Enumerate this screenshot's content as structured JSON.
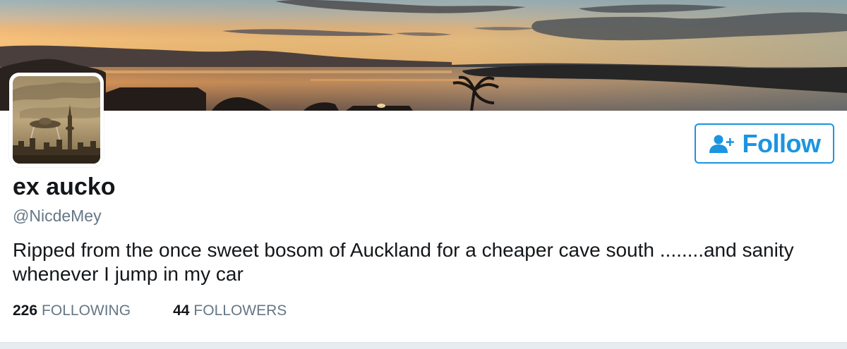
{
  "profile": {
    "display_name": "ex aucko",
    "screen_name": "@NicdeMey",
    "bio": "Ripped from the once sweet bosom of Auckland for a cheaper cave south ........and sanity whenever I jump in my car"
  },
  "follow_button": {
    "label": "Follow",
    "icon": "add-user-icon"
  },
  "stats": [
    {
      "count": "226",
      "label": "FOLLOWING"
    },
    {
      "count": "44",
      "label": "FOLLOWERS"
    }
  ],
  "colors": {
    "accent": "#1b95e0",
    "text_primary": "#14171a",
    "text_secondary": "#657786"
  }
}
